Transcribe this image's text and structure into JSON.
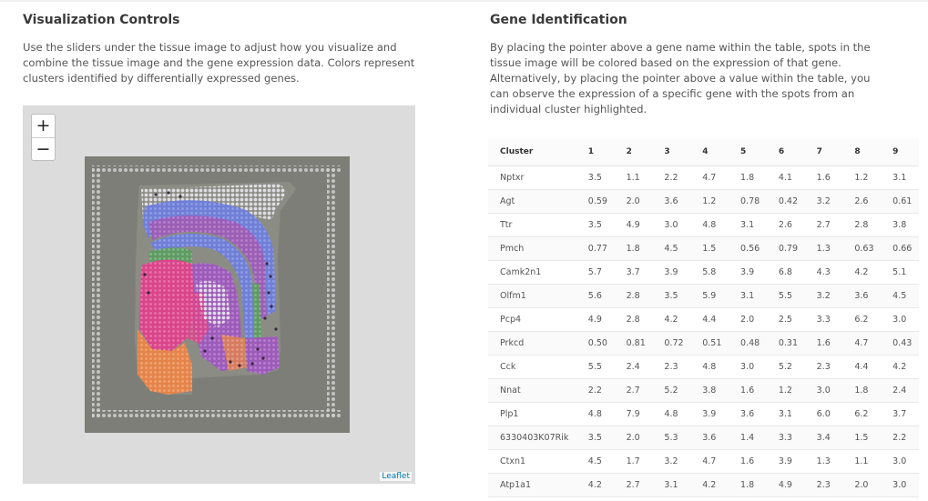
{
  "visualization": {
    "title": "Visualization Controls",
    "description": "Use the sliders under the tissue image to adjust how you visualize and combine the tissue image and the gene expression data. Colors represent clusters identified by differentially expressed genes.",
    "zoom_in": "+",
    "zoom_out": "−",
    "attribution": "Leaflet"
  },
  "gene_identification": {
    "title": "Gene Identification",
    "description": "By placing the pointer above a gene name within the table, spots in the tissue image will be colored based on the expression of that gene. Alternatively, by placing the pointer above a value within the table, you can observe the expression of a specific gene with the spots from an individual cluster highlighted."
  },
  "table": {
    "headers": [
      "Cluster",
      "1",
      "2",
      "3",
      "4",
      "5",
      "6",
      "7",
      "8",
      "9"
    ],
    "rows": [
      [
        "Nptxr",
        "3.5",
        "1.1",
        "2.2",
        "4.7",
        "1.8",
        "4.1",
        "1.6",
        "1.2",
        "3.1"
      ],
      [
        "Agt",
        "0.59",
        "2.0",
        "3.6",
        "1.2",
        "0.78",
        "0.42",
        "3.2",
        "2.6",
        "0.61"
      ],
      [
        "Ttr",
        "3.5",
        "4.9",
        "3.0",
        "4.8",
        "3.1",
        "2.6",
        "2.7",
        "2.8",
        "3.8"
      ],
      [
        "Pmch",
        "0.77",
        "1.8",
        "4.5",
        "1.5",
        "0.56",
        "0.79",
        "1.3",
        "0.63",
        "0.66"
      ],
      [
        "Camk2n1",
        "5.7",
        "3.7",
        "3.9",
        "5.8",
        "3.9",
        "6.8",
        "4.3",
        "4.2",
        "5.1"
      ],
      [
        "Olfm1",
        "5.6",
        "2.8",
        "3.5",
        "5.9",
        "3.1",
        "5.5",
        "3.2",
        "3.6",
        "4.5"
      ],
      [
        "Pcp4",
        "4.9",
        "2.8",
        "4.2",
        "4.4",
        "2.0",
        "2.5",
        "3.3",
        "6.2",
        "3.0"
      ],
      [
        "Prkcd",
        "0.50",
        "0.81",
        "0.72",
        "0.51",
        "0.48",
        "0.31",
        "1.6",
        "4.7",
        "0.43"
      ],
      [
        "Cck",
        "5.5",
        "2.4",
        "2.3",
        "4.8",
        "3.0",
        "5.2",
        "2.3",
        "4.4",
        "4.2"
      ],
      [
        "Nnat",
        "2.2",
        "2.7",
        "5.2",
        "3.8",
        "1.6",
        "1.2",
        "3.0",
        "1.8",
        "2.4"
      ],
      [
        "Plp1",
        "4.8",
        "7.9",
        "4.8",
        "3.9",
        "3.6",
        "3.1",
        "6.0",
        "6.2",
        "3.7"
      ],
      [
        "6330403K07Rik",
        "3.5",
        "2.0",
        "5.3",
        "3.6",
        "1.4",
        "3.3",
        "3.4",
        "1.5",
        "2.2"
      ],
      [
        "Ctxn1",
        "4.5",
        "1.7",
        "3.2",
        "4.7",
        "1.6",
        "3.9",
        "1.3",
        "1.1",
        "3.0"
      ],
      [
        "Atp1a1",
        "4.2",
        "2.7",
        "3.1",
        "4.2",
        "1.8",
        "4.9",
        "2.3",
        "2.0",
        "3.0"
      ]
    ]
  },
  "colors": {
    "cluster_blue": "#6f7fd6",
    "cluster_purple": "#9b5bb8",
    "cluster_pink": "#d8458a",
    "cluster_orange": "#e4844a",
    "cluster_green": "#5f9a63",
    "link_blue": "#0078A8"
  }
}
